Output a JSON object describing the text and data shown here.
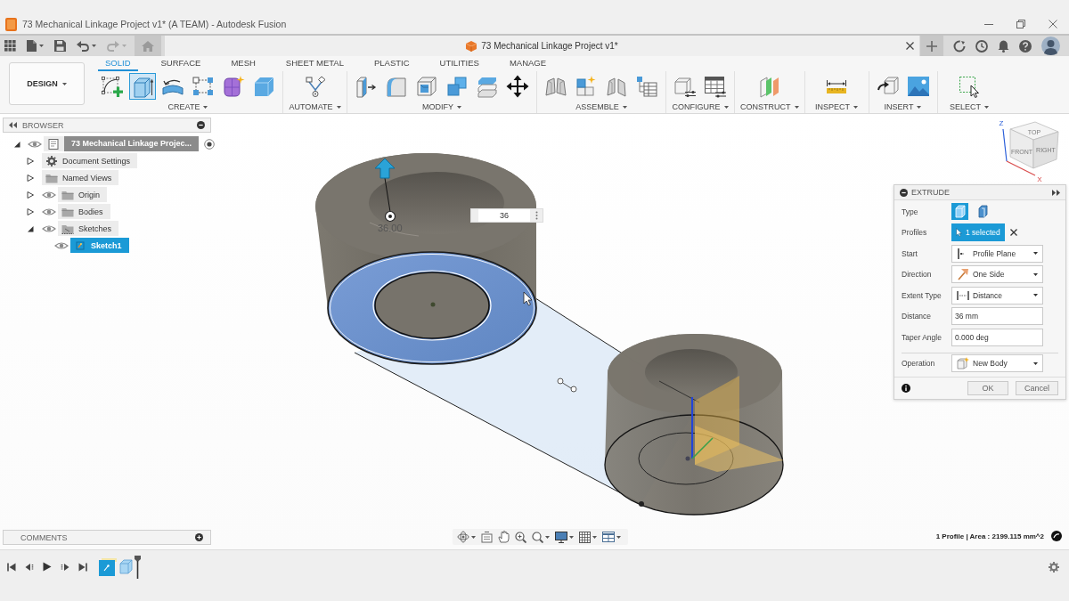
{
  "window": {
    "title": "73 Mechanical Linkage Project v1* (A TEAM) - Autodesk Fusion"
  },
  "document_tab": {
    "title": "73 Mechanical Linkage Project v1*"
  },
  "workspace": {
    "label": "DESIGN"
  },
  "toolbar_tabs": [
    {
      "label": "SOLID",
      "selected": true
    },
    {
      "label": "SURFACE",
      "selected": false
    },
    {
      "label": "MESH",
      "selected": false
    },
    {
      "label": "SHEET METAL",
      "selected": false
    },
    {
      "label": "PLASTIC",
      "selected": false
    },
    {
      "label": "UTILITIES",
      "selected": false
    },
    {
      "label": "MANAGE",
      "selected": false
    }
  ],
  "tool_groups": [
    {
      "label": "CREATE",
      "tools": [
        {
          "kind": "sketch",
          "selected": false
        },
        {
          "kind": "extrude",
          "selected": true
        },
        {
          "kind": "revolve",
          "selected": false
        },
        {
          "kind": "pattern",
          "selected": false
        },
        {
          "kind": "form",
          "selected": false
        },
        {
          "kind": "box",
          "selected": false
        }
      ]
    },
    {
      "label": "AUTOMATE",
      "tools": [
        {
          "kind": "automate",
          "selected": false
        }
      ]
    },
    {
      "label": "MODIFY",
      "tools": [
        {
          "kind": "presspull",
          "selected": false
        },
        {
          "kind": "fillet",
          "selected": false
        },
        {
          "kind": "shell",
          "selected": false
        },
        {
          "kind": "combine",
          "selected": false
        },
        {
          "kind": "offset",
          "selected": false
        },
        {
          "kind": "move",
          "selected": false
        }
      ]
    },
    {
      "label": "ASSEMBLE",
      "tools": [
        {
          "kind": "joint",
          "selected": false
        },
        {
          "kind": "component",
          "selected": false
        },
        {
          "kind": "asbuilt",
          "selected": false
        },
        {
          "kind": "bom",
          "selected": false
        }
      ]
    },
    {
      "label": "CONFIGURE",
      "tools": [
        {
          "kind": "configure",
          "selected": false
        },
        {
          "kind": "table",
          "selected": false
        }
      ]
    },
    {
      "label": "CONSTRUCT",
      "tools": [
        {
          "kind": "plane",
          "selected": false
        }
      ]
    },
    {
      "label": "INSPECT",
      "tools": [
        {
          "kind": "measure",
          "selected": false
        }
      ]
    },
    {
      "label": "INSERT",
      "tools": [
        {
          "kind": "insert",
          "selected": false
        },
        {
          "kind": "image",
          "selected": false
        }
      ]
    },
    {
      "label": "SELECT",
      "tools": [
        {
          "kind": "select",
          "selected": false
        }
      ]
    }
  ],
  "browser": {
    "title": "BROWSER",
    "tree": [
      {
        "label": "73 Mechanical Linkage Projec...",
        "kind": "document",
        "expanded": true,
        "eye": true,
        "active": true,
        "selected": false,
        "children": [
          {
            "label": "Document Settings",
            "kind": "settings",
            "expanded": false,
            "selected": false
          },
          {
            "label": "Named Views",
            "kind": "folder",
            "expanded": false,
            "selected": false
          },
          {
            "label": "Origin",
            "kind": "folder",
            "expanded": false,
            "eye": true,
            "selected": false
          },
          {
            "label": "Bodies",
            "kind": "folder",
            "expanded": false,
            "eye": true,
            "selected": false
          },
          {
            "label": "Sketches",
            "kind": "sketches",
            "expanded": true,
            "eye": true,
            "selected": false,
            "children": [
              {
                "label": "Sketch1",
                "kind": "sketch",
                "eye": true,
                "selected": true
              }
            ]
          }
        ]
      }
    ]
  },
  "viewport": {
    "dimension_label": "36.00",
    "distance_input": {
      "value": "36"
    }
  },
  "view_cube": {
    "faces": [
      "TOP",
      "FRONT",
      "RIGHT"
    ],
    "axes": [
      "Z",
      "X"
    ]
  },
  "extrude": {
    "title": "EXTRUDE",
    "rows": [
      {
        "label": "Type",
        "kind": "type",
        "options": [
          {
            "kind": "solid",
            "selected": true
          },
          {
            "kind": "thin",
            "selected": false
          }
        ]
      },
      {
        "label": "Profiles",
        "kind": "selection",
        "value": "1 selected"
      },
      {
        "label": "Start",
        "kind": "start",
        "value": "Profile Plane"
      },
      {
        "label": "Direction",
        "kind": "direction",
        "value": "One Side"
      },
      {
        "label": "Extent Type",
        "kind": "extent",
        "value": "Distance"
      },
      {
        "label": "Distance",
        "kind": "distance",
        "value": "36 mm"
      },
      {
        "label": "Taper Angle",
        "kind": "angle",
        "value": "0.000 deg"
      },
      {
        "label": "Operation",
        "kind": "operation",
        "value": "New Body"
      }
    ],
    "buttons": [
      "OK",
      "Cancel"
    ]
  },
  "comments": {
    "title": "COMMENTS"
  },
  "status_bar": {
    "text": "1 Profile | Area : 2199.115 mm^2"
  }
}
